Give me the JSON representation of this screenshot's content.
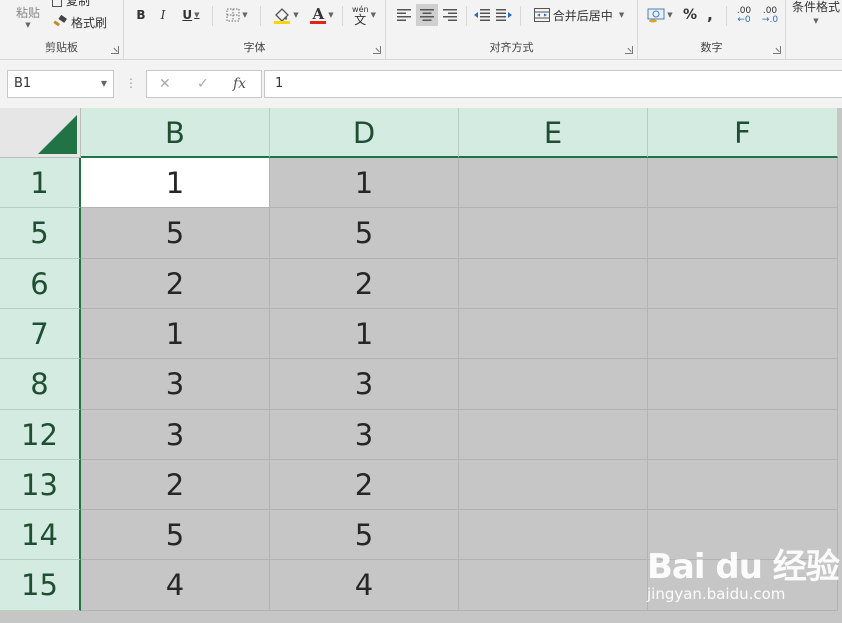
{
  "ribbon": {
    "clipboard": {
      "paste_label": "粘贴",
      "copy_label": "复制",
      "format_painter_label": "格式刷",
      "group_label": "剪贴板"
    },
    "font": {
      "bold_label": "B",
      "italic_label": "I",
      "underline_label": "U",
      "font_color_glyph": "A",
      "phonetic_glyph": "文",
      "phonetic_top": "wén",
      "group_label": "字体"
    },
    "alignment": {
      "merge_center_label": "合并后居中",
      "group_label": "对齐方式"
    },
    "number": {
      "percent_label": "%",
      "comma_label": ",",
      "inc_decimal_top": ".00",
      "inc_decimal_bottom": "←0",
      "dec_decimal_top": ".00",
      "dec_decimal_bottom": "→.0",
      "group_label": "数字"
    },
    "styles": {
      "conditional_format_label": "条件格式"
    }
  },
  "formula_bar": {
    "name_box": "B1",
    "cancel_glyph": "✕",
    "enter_glyph": "✓",
    "fx_label": "fx",
    "value": "1"
  },
  "grid": {
    "columns": [
      "B",
      "D",
      "E",
      "F"
    ],
    "rows": [
      {
        "header": "1",
        "B": "1",
        "D": "1"
      },
      {
        "header": "5",
        "B": "5",
        "D": "5"
      },
      {
        "header": "6",
        "B": "2",
        "D": "2"
      },
      {
        "header": "7",
        "B": "1",
        "D": "1"
      },
      {
        "header": "8",
        "B": "3",
        "D": "3"
      },
      {
        "header": "12",
        "B": "3",
        "D": "3"
      },
      {
        "header": "13",
        "B": "2",
        "D": "2"
      },
      {
        "header": "14",
        "B": "5",
        "D": "5"
      },
      {
        "header": "15",
        "B": "4",
        "D": "4"
      }
    ],
    "active_cell": "B1"
  },
  "watermark": {
    "logo_text": "Bai du 经验",
    "url_text": "jingyan.baidu.com"
  },
  "colors": {
    "header_bg": "#d3ebe0",
    "header_accent": "#217346",
    "selection_fill": "#c6c6c6",
    "ribbon_bg": "#f3f3f3"
  }
}
